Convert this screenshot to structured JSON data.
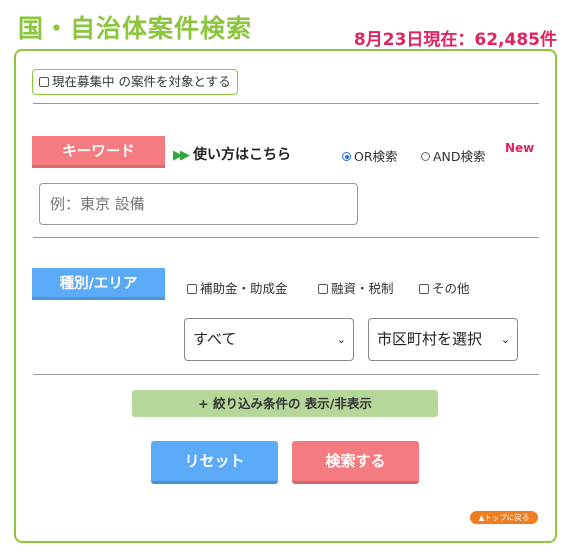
{
  "header": {
    "title": "国・自治体案件検索",
    "count_text": "8月23日現在：62,485件"
  },
  "filters": {
    "recruiting_only_label": "現在募集中 の案件を対象とする"
  },
  "keyword": {
    "section_label": "キーワード",
    "howto_label": "使い方はこちら",
    "search_mode": {
      "selected": "OR検索",
      "options": [
        "OR検索",
        "AND検索"
      ]
    },
    "new_badge": "New",
    "input_placeholder": "例：東京 設備",
    "input_value": ""
  },
  "category": {
    "section_label": "種別/エリア",
    "checkboxes": [
      "補助金・助成金",
      "融資・税制",
      "その他"
    ],
    "type_select": "すべて",
    "city_select": "市区町村を選択"
  },
  "toggle_label": "+  絞り込み条件の 表示/非表示",
  "buttons": {
    "reset": "リセット",
    "search": "検索する",
    "back_to_top": "▲トップに戻る"
  },
  "colors": {
    "accent_green": "#8cc63f",
    "count_red": "#e0245e",
    "keyword_pink": "#f47b7f",
    "area_blue": "#5aaaf7",
    "toggle_green": "#b5d89a",
    "top_orange": "#ef7d21"
  }
}
